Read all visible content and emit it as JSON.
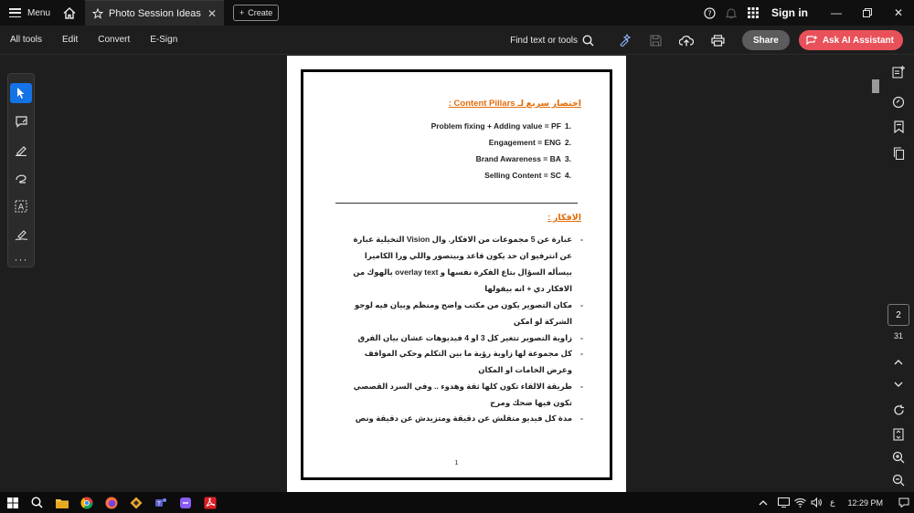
{
  "titlebar": {
    "menu_label": "Menu",
    "tab_title": "Photo Session Ideas",
    "create_label": "Create",
    "signin_label": "Sign in"
  },
  "toolbar": {
    "all_tools": "All tools",
    "edit": "Edit",
    "convert": "Convert",
    "esign": "E-Sign",
    "find_label": "Find text or tools",
    "share_label": "Share",
    "ai_label": "Ask AI Assistant"
  },
  "document": {
    "heading1": "اختصار سريع لـ Content Pillars :",
    "pillars": [
      {
        "num": ".1",
        "text": "Problem fixing + Adding value = PF"
      },
      {
        "num": ".2",
        "text": "Engagement = ENG"
      },
      {
        "num": ".3",
        "text": "Brand Awareness = BA"
      },
      {
        "num": ".4",
        "text": "Selling Content = SC"
      }
    ],
    "heading2": "الافكار :",
    "bullets": [
      "عبارة عن 5 مجموعات من الافكار. وال Vision التخيلية عبارة عن انترفيو ان حد يكون قاعد وبيتصور واللي ورا الكاميرا بيسأله السؤال بتاع الفكرة نفسها و overlay text بالهوك من الافكار دي + انه بيقولها",
      "مكان التصوير يكون من مكتب واضح ومنظم وبيان فيه لوجو الشركة لو امكن",
      "زاوية التصوير تتغير كل 3 او 4 فيديوهات عشان بيان الفرق",
      "كل مجموعة لها زاوية رؤية ما بين التكلم وحكي المواقف وعرض الخامات او المكان",
      "طريقة الالقاء تكون كلها ثقة وهدوء .. وفي السرد القصصي تكون فيها ضحك ومرح",
      "مدة كل فيديو متقلش عن دقيقة ومتزيدش عن دقيقة ونص"
    ],
    "page_number": "1"
  },
  "navigation": {
    "current_page": "2",
    "total_pages": "31"
  },
  "taskbar": {
    "time": "12:29 PM",
    "lang": "ع"
  },
  "colors": {
    "accent_blue": "#1473e6",
    "ai_button": "#e9515a",
    "heading_orange": "#e36c09"
  }
}
